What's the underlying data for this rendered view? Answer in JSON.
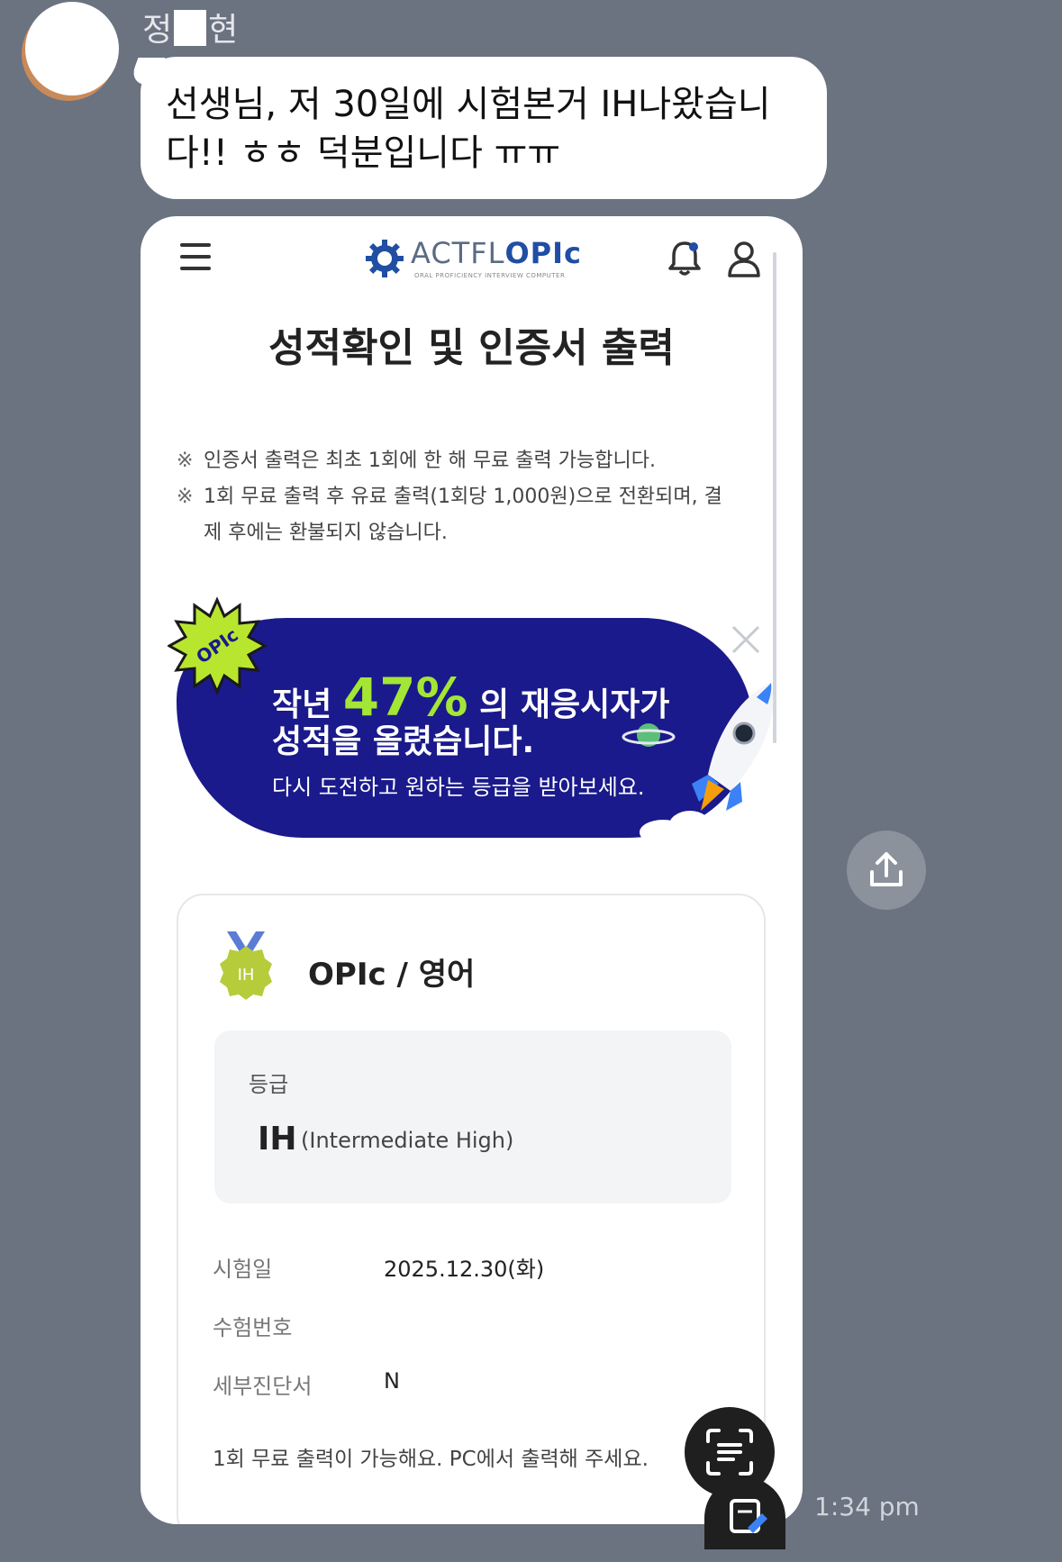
{
  "chat": {
    "sender_name_prefix": "정",
    "sender_name_suffix": "현",
    "message_line1": "선생님, 저 30일에 시험본거 IH나왔습니",
    "message_line2": "다!! ㅎㅎ 덕분입니다 ㅠㅠ",
    "timestamp": "1:34 pm"
  },
  "screenshot": {
    "logo_text_plain": "ACTFL",
    "logo_text_bold": "OPIc",
    "logo_subtitle": "ORAL PROFICIENCY INTERVIEW",
    "logo_subtitle2": "COMPUTER",
    "page_title": "성적확인 및 인증서 출력",
    "notes": [
      "인증서 출력은 최초 1회에 한 해 무료 출력 가능합니다.",
      "1회 무료 출력 후 유료 출력(1회당 1,000원)으로 전환되며, 결",
      "제 후에는 환불되지 않습니다."
    ],
    "note_mark": "※",
    "banner": {
      "badge": "OPIc",
      "line1_prefix": "작년",
      "percent": "47%",
      "line1_suffix": "의 재응시자가",
      "line2": "성적을 올렸습니다.",
      "line3": "다시 도전하고 원하는 등급을 받아보세요."
    },
    "result": {
      "medal_text": "IH",
      "exam_name": "OPIc / 영어",
      "grade_label": "등급",
      "grade_value": "IH",
      "grade_desc": "(Intermediate High)",
      "rows": [
        {
          "label": "시험일",
          "value": "2025.12.30(화)"
        },
        {
          "label": "수험번호",
          "value": ""
        },
        {
          "label": "세부진단서",
          "value": "N"
        }
      ],
      "footnote": "1회 무료 출력이 가능해요. PC에서 출력해 주세요."
    }
  },
  "colors": {
    "background": "#6b7280",
    "banner": "#1a1a8c",
    "accent_green": "#a3e635",
    "logo_blue": "#1f4ea3"
  },
  "icons": [
    "menu-icon",
    "bell-icon",
    "user-icon",
    "close-icon",
    "share-icon",
    "text-scan-icon",
    "memo-icon"
  ]
}
